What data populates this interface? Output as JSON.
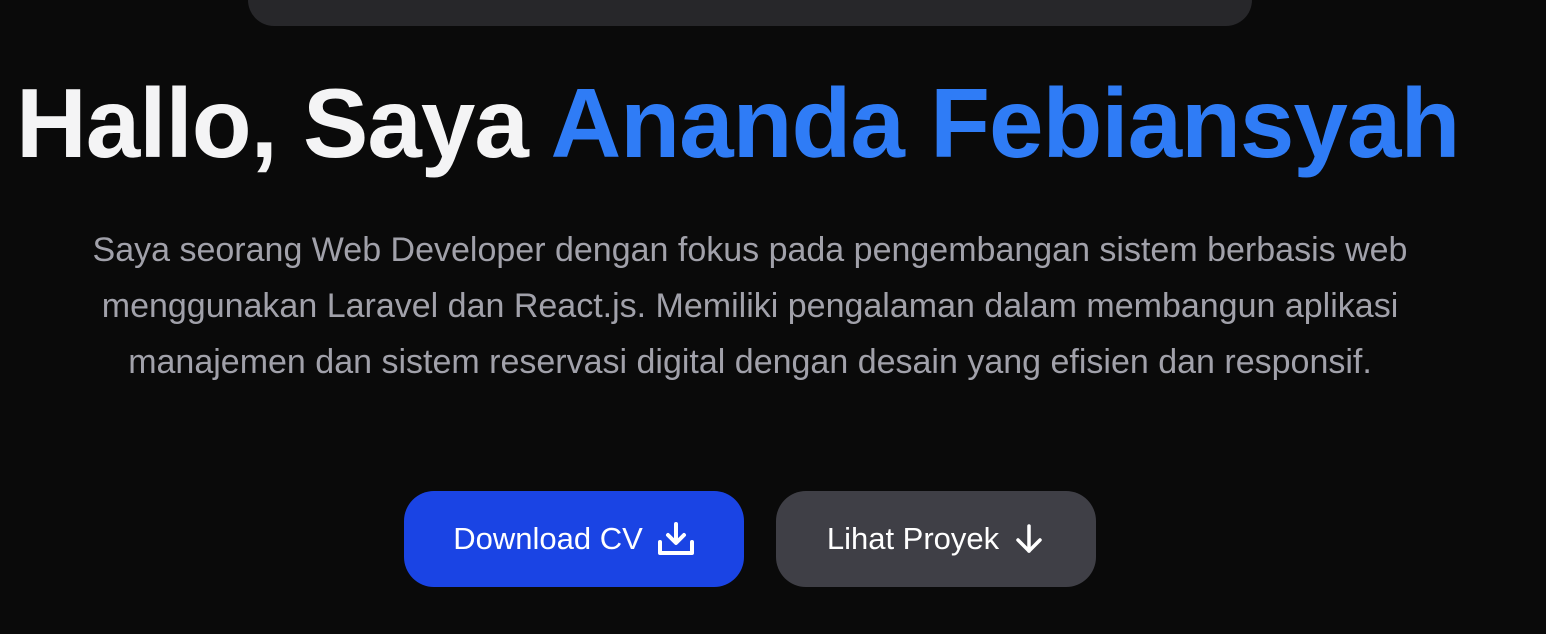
{
  "hero": {
    "greeting": "Hallo, Saya ",
    "name": "Ananda Febiansyah",
    "description": "Saya seorang Web Developer dengan fokus pada pengembangan sistem berbasis web menggunakan Laravel dan React.js. Memiliki pengalaman dalam membangun aplikasi manajemen dan sistem reservasi digital dengan desain yang efisien dan responsif."
  },
  "buttons": {
    "download_cv": {
      "label": "Download CV",
      "icon": "download-icon"
    },
    "view_projects": {
      "label": "Lihat Proyek",
      "icon": "arrow-down-icon"
    }
  },
  "colors": {
    "background": "#0a0a0a",
    "accent": "#2f7cf6",
    "primary_button": "#1a44e4",
    "secondary_button": "#3f3f46",
    "navbar": "#27272a"
  }
}
